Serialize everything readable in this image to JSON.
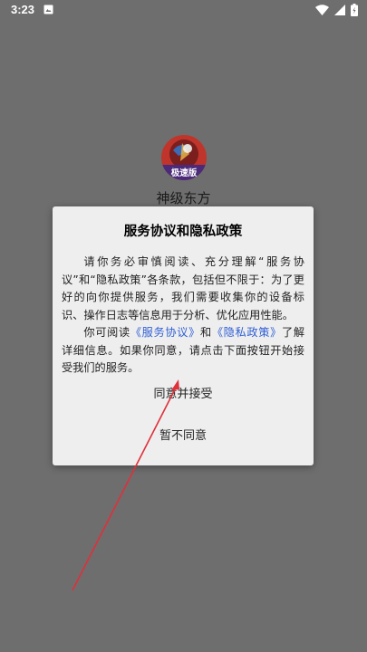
{
  "status_bar": {
    "time": "3:23",
    "icons": [
      "notification-icon",
      "wifi-icon",
      "cellular-signal-icon",
      "battery-charging-icon"
    ]
  },
  "app": {
    "icon_name": "app-logo-icon",
    "icon_badge": "极速版",
    "name": "神级东方"
  },
  "dialog": {
    "title": "服务协议和隐私政策",
    "paragraph1": "请你务必审慎阅读、充分理解“服务协议”和“隐私政策”各条款，包括但不限于：为了更好的向你提供服务，我们需要收集你的设备标识、操作日志等信息用于分析、优化应用性能。",
    "paragraph2_before": "你可阅读",
    "link_service": "《服务协议》",
    "paragraph2_and": "和",
    "link_privacy": "《隐私政策》",
    "paragraph2_after": "了解详细信息。如果你同意，请点击下面按钮开始接受我们的服务。",
    "agree_button": "同意并接受",
    "disagree_button": "暂不同意"
  },
  "colors": {
    "overlay": "#6e6e6e",
    "dialog_bg": "#eeeeee",
    "link": "#2f5fd6",
    "annotation_arrow": "#e0303a"
  }
}
